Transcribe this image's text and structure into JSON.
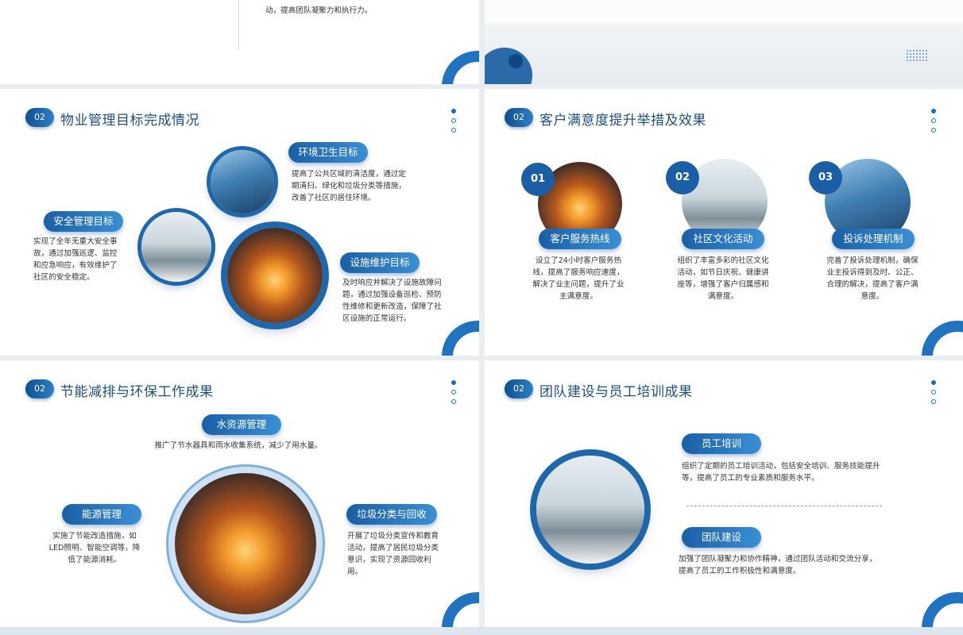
{
  "top_left": {
    "text": "动，提高团队凝聚力和执行力。"
  },
  "slide_goals": {
    "badge": "02",
    "title": "物业管理目标完成情况",
    "env": {
      "label": "环境卫生目标",
      "text": "提高了公共区域的清洁度，通过定期清扫、绿化和垃圾分类等措施，改善了社区的居住环境。"
    },
    "safety": {
      "label": "安全管理目标",
      "text": "实现了全年无重大安全事故，通过加强巡逻、监控和应急响应，有效维护了社区的安全稳定。"
    },
    "facility": {
      "label": "设施维护目标",
      "text": "及时响应并解决了设施故障问题，通过加强设备巡检、预防性维修和更新改造，保障了社区设施的正常运行。"
    }
  },
  "slide_satisfaction": {
    "badge": "02",
    "title": "客户满意度提升举措及效果",
    "items": [
      {
        "num": "01",
        "label": "客户服务热线",
        "text": "设立了24小时客户服务热线，提高了服务响应速度，解决了业主问题，提升了业主满意度。"
      },
      {
        "num": "02",
        "label": "社区文化活动",
        "text": "组织了丰富多彩的社区文化活动，如节日庆祝、健康讲座等，增强了客户归属感和满意度。"
      },
      {
        "num": "03",
        "label": "投诉处理机制",
        "text": "完善了投诉处理机制，确保业主投诉得到及时、公正、合理的解决，提高了客户满意度。"
      }
    ]
  },
  "slide_energy": {
    "badge": "02",
    "title": "节能减排与环保工作成果",
    "water": {
      "label": "水资源管理",
      "text": "推广了节水器具和雨水收集系统，减少了用水量。"
    },
    "energy": {
      "label": "能源管理",
      "text": "实施了节能改造措施，如LED照明、智能空调等，降低了能源消耗。"
    },
    "waste": {
      "label": "垃圾分类与回收",
      "text": "开展了垃圾分类宣传和教育活动，提高了居民垃圾分类意识，实现了资源回收利用。"
    }
  },
  "slide_team": {
    "badge": "02",
    "title": "团队建设与员工培训成果",
    "training": {
      "label": "员工培训",
      "text": "组织了定期的员工培训活动，包括安全培训、服务技能提升等，提高了员工的专业素质和服务水平。"
    },
    "team": {
      "label": "团队建设",
      "text": "加强了团队凝聚力和协作精神，通过团队活动和交流分享，提高了员工的工作积极性和满意度。"
    }
  }
}
